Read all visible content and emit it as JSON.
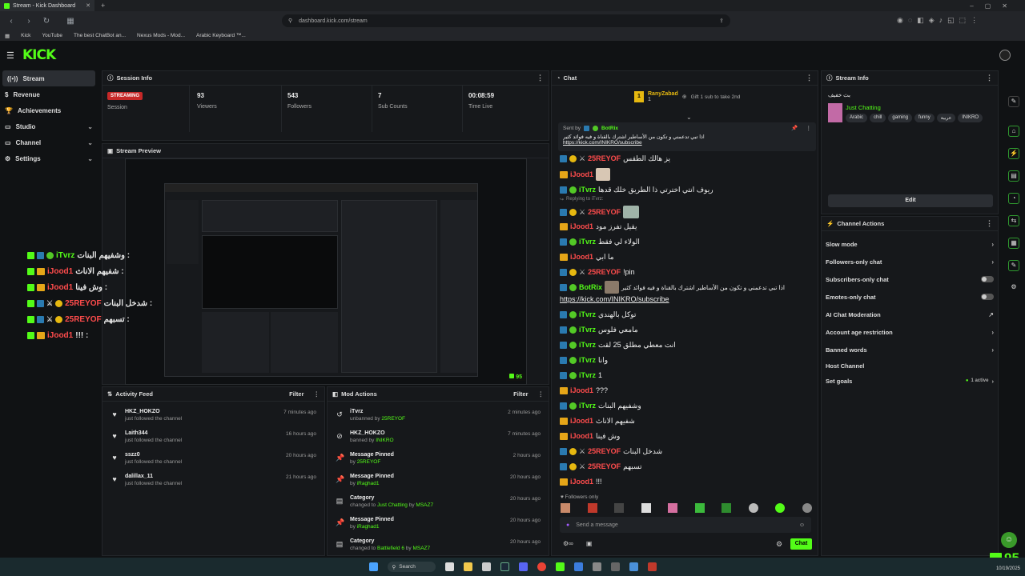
{
  "browser": {
    "tab_title": "Stream - Kick Dashboard",
    "url": "dashboard.kick.com/stream",
    "bookmarks": [
      "Kick",
      "YouTube",
      "The best ChatBot an...",
      "Nexus Mods - Mod...",
      "Arabic Keyboard ™..."
    ]
  },
  "app": {
    "logo": "KICK"
  },
  "sidebar": {
    "items": [
      {
        "label": "Stream",
        "icon": "stream-icon",
        "active": true
      },
      {
        "label": "Revenue",
        "icon": "revenue-icon"
      },
      {
        "label": "Achievements",
        "icon": "trophy-icon"
      },
      {
        "label": "Studio",
        "icon": "studio-icon",
        "expandable": true
      },
      {
        "label": "Channel",
        "icon": "channel-icon",
        "expandable": true
      },
      {
        "label": "Settings",
        "icon": "gear-icon",
        "expandable": true
      }
    ]
  },
  "session_info": {
    "title": "Session Info",
    "status_badge": "STREAMING",
    "status_label": "Session",
    "viewers": "93",
    "viewers_label": "Viewers",
    "followers": "543",
    "followers_label": "Followers",
    "subs": "7",
    "subs_label": "Sub Counts",
    "time_live": "00:08:59",
    "time_live_label": "Time Live"
  },
  "stream_preview": {
    "title": "Stream Preview",
    "viewer_count": "95"
  },
  "overlay_chat": [
    {
      "user": "iTvrz",
      "text": "وشفيهم البنات :",
      "color": "#53fc18"
    },
    {
      "user": "iJood1",
      "text": "شفيهم الاناث :",
      "color": "#ff4c4c"
    },
    {
      "user": "iJood1",
      "text": "وش فينا :",
      "color": "#ff4c4c"
    },
    {
      "user": "25REYOF",
      "text": "شدخل البنات :",
      "color": "#ff4c4c"
    },
    {
      "user": "25REYOF",
      "text": "تسبهم :",
      "color": "#ff4c4c"
    },
    {
      "user": "iJood1",
      "text": "!!! :",
      "color": "#ff4c4c"
    }
  ],
  "activity_feed": {
    "title": "Activity Feed",
    "filter": "Filter",
    "items": [
      {
        "user": "HKZ_HOKZO",
        "sub": "just followed the channel",
        "time": "7 minutes ago"
      },
      {
        "user": "Laith344",
        "sub": "just followed the channel",
        "time": "16 hours ago"
      },
      {
        "user": "sszz0",
        "sub": "just followed the channel",
        "time": "20 hours ago"
      },
      {
        "user": "dalillax_11",
        "sub": "just followed the channel",
        "time": "21 hours ago"
      }
    ]
  },
  "mod_actions": {
    "title": "Mod Actions",
    "filter": "Filter",
    "items": [
      {
        "title": "iTvrz",
        "pre": "unbanned by",
        "by": "25REYOF",
        "time": "2 minutes ago",
        "icon": "undo-icon"
      },
      {
        "title": "HKZ_HOKZO",
        "pre": "banned by",
        "by": "INIKRO",
        "time": "7 minutes ago",
        "icon": "ban-icon"
      },
      {
        "title": "Message Pinned",
        "pre": "by",
        "by": "25REYOF",
        "time": "2 hours ago",
        "icon": "pin-icon"
      },
      {
        "title": "Message Pinned",
        "pre": "by",
        "by": "iRaghad1",
        "time": "20 hours ago",
        "icon": "pin-icon"
      },
      {
        "title": "Category",
        "pre": "changed to",
        "by": "Just Chatting",
        "post": "by",
        "by2": "MSAZ7",
        "time": "20 hours ago",
        "icon": "category-icon"
      },
      {
        "title": "Message Pinned",
        "pre": "by",
        "by": "iRaghad1",
        "time": "20 hours ago",
        "icon": "pin-icon"
      },
      {
        "title": "Category",
        "pre": "changed to",
        "by": "Battlefield 6",
        "post": "by",
        "by2": "MSAZ7",
        "time": "20 hours ago",
        "icon": "category-icon"
      }
    ]
  },
  "chat": {
    "title": "Chat",
    "gift_user": "RanyZabad",
    "gift_count": "1",
    "gift_text": "Gift 1 sub to take 2nd",
    "pinned_label": "Sent by",
    "pinned_user": "BotRix",
    "pinned_text": "اذا تبي تدعمني و تكون من الأساطير اشترك بالقناة و فيه فوائد كثير",
    "pinned_link": "https://kick.com/INIKRO/subscribe",
    "replying_label": "Replying to iTvrz:",
    "messages": [
      {
        "user": "25REYOF",
        "color": "#ff4c4c",
        "text": "يز هالك الطقس"
      },
      {
        "user": "iJood1",
        "color": "#ff4c4c",
        "text": ""
      },
      {
        "user": "iTvrz",
        "color": "#53fc18",
        "text": "ريوف انتي اخترتي ذا الطريق خلك قدها"
      },
      {
        "user": "25REYOF",
        "color": "#ff4c4c",
        "text": ""
      },
      {
        "user": "iJood1",
        "color": "#ff4c4c",
        "text": "يقيل تفرز مود"
      },
      {
        "user": "iTvrz",
        "color": "#53fc18",
        "text": "الولاء لي فقط"
      },
      {
        "user": "iJood1",
        "color": "#ff4c4c",
        "text": "ما ابي"
      },
      {
        "user": "25REYOF",
        "color": "#ff4c4c",
        "text": "!pin"
      },
      {
        "user": "BotRix",
        "color": "#53fc18",
        "text": "اذا تبي تدعمني و تكون من الأساطير اشترك بالقناة و فيه فوائد كثير"
      },
      {
        "user": "",
        "color": "#bbb",
        "text": "https://kick.com/INIKRO/subscribe",
        "link": true
      },
      {
        "user": "iTvrz",
        "color": "#53fc18",
        "text": "توكل بالهندي"
      },
      {
        "user": "iTvrz",
        "color": "#53fc18",
        "text": "مامعي فلوس"
      },
      {
        "user": "iTvrz",
        "color": "#53fc18",
        "text": "انت معطي مطلق 25 لقت"
      },
      {
        "user": "iTvrz",
        "color": "#53fc18",
        "text": "وانا"
      },
      {
        "user": "iTvrz",
        "color": "#53fc18",
        "text": "1"
      },
      {
        "user": "iJood1",
        "color": "#ff4c4c",
        "text": "???"
      },
      {
        "user": "iTvrz",
        "color": "#53fc18",
        "text": "وشفيهم البنات"
      },
      {
        "user": "iJood1",
        "color": "#ff4c4c",
        "text": "شفيهم الاناث"
      },
      {
        "user": "iJood1",
        "color": "#ff4c4c",
        "text": "وش فينا"
      },
      {
        "user": "25REYOF",
        "color": "#ff4c4c",
        "text": "شدخل البنات"
      },
      {
        "user": "25REYOF",
        "color": "#ff4c4c",
        "text": "تسبهم"
      },
      {
        "user": "iJood1",
        "color": "#ff4c4c",
        "text": "!!!"
      }
    ],
    "mode_label": "Followers only",
    "input_placeholder": "Send a message",
    "send_label": "Chat"
  },
  "stream_info": {
    "title": "Stream Info",
    "stream_title": "بث خفيف",
    "category": "Just Chatting",
    "tags": [
      "Arabic",
      "chill",
      "gaming",
      "funny",
      "عربية",
      "INIKRO"
    ],
    "edit_label": "Edit"
  },
  "channel_actions": {
    "title": "Channel Actions",
    "items": [
      {
        "label": "Slow mode",
        "type": "chevron"
      },
      {
        "label": "Followers-only chat",
        "type": "chevron"
      },
      {
        "label": "Subscribers-only chat",
        "type": "toggle"
      },
      {
        "label": "Emotes-only chat",
        "type": "toggle"
      },
      {
        "label": "AI Chat Moderation",
        "type": "external"
      },
      {
        "label": "Account age restriction",
        "type": "chevron"
      },
      {
        "label": "Banned words",
        "type": "chevron"
      },
      {
        "label": "Host Channel",
        "type": "none"
      },
      {
        "label": "Set goals",
        "type": "chevron",
        "status": "1 active"
      }
    ]
  },
  "taskbar": {
    "search_label": "Search",
    "clock_date": "10/19/2025"
  },
  "watermark": {
    "count": "95"
  },
  "colors": {
    "brand": "#53fc18",
    "bg": "#101214",
    "panel": "#16181b",
    "red": "#ff4c4c"
  }
}
